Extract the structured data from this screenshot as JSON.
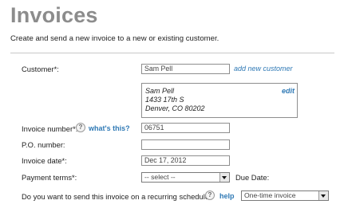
{
  "page": {
    "title": "Invoices",
    "subtitle": "Create and send a new invoice to a new or existing customer."
  },
  "form": {
    "customer": {
      "label": "Customer*:",
      "value": "Sam Pell",
      "add_link": "add new customer",
      "address": {
        "name": "Sam Pell",
        "street": "1433 17th S",
        "city": "Denver, CO 80202",
        "edit_link": "edit"
      }
    },
    "invoice_number": {
      "label": "Invoice number*:",
      "help_icon": "?",
      "help_link": "what's this?",
      "value": "06751"
    },
    "po_number": {
      "label": "P.O. number:",
      "value": ""
    },
    "invoice_date": {
      "label": "Invoice date*:",
      "value": "Dec 17, 2012"
    },
    "payment_terms": {
      "label": "Payment terms*:",
      "selected": "-- select --",
      "due_date_label": "Due Date:"
    },
    "recurring": {
      "label": "Do you want to send this invoice on a recurring schedule?",
      "help_icon": "?",
      "help_link": "help",
      "selected": "One-time invoice"
    }
  }
}
